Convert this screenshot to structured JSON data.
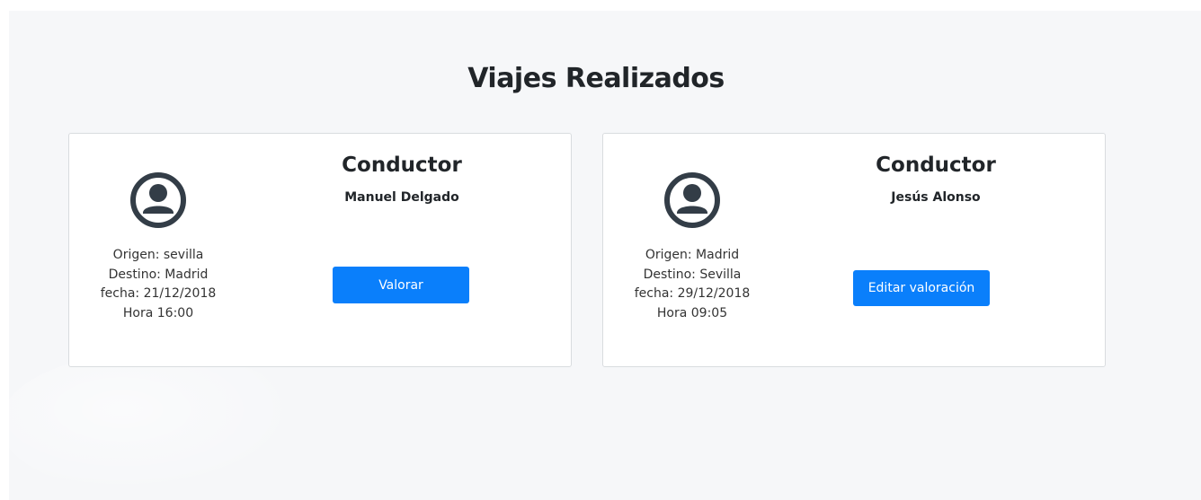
{
  "page": {
    "title": "Viajes Realizados"
  },
  "trips": [
    {
      "role": "Conductor",
      "driver": "Manuel Delgado",
      "origin": "Origen: sevilla",
      "destination": "Destino: Madrid",
      "date": "fecha: 21/12/2018",
      "time": "Hora 16:00",
      "action": "Valorar",
      "avatar_icon": "user-circle-icon"
    },
    {
      "role": "Conductor",
      "driver": "Jesús Alonso",
      "origin": "Origen: Madrid",
      "destination": "Destino: Sevilla",
      "date": "fecha: 29/12/2018",
      "time": "Hora 09:05",
      "action": "Editar valoración",
      "avatar_icon": "user-circle-icon"
    }
  ],
  "colors": {
    "accent": "#0a7ffb",
    "background": "#f6f7f9",
    "icon": "#333d47"
  }
}
